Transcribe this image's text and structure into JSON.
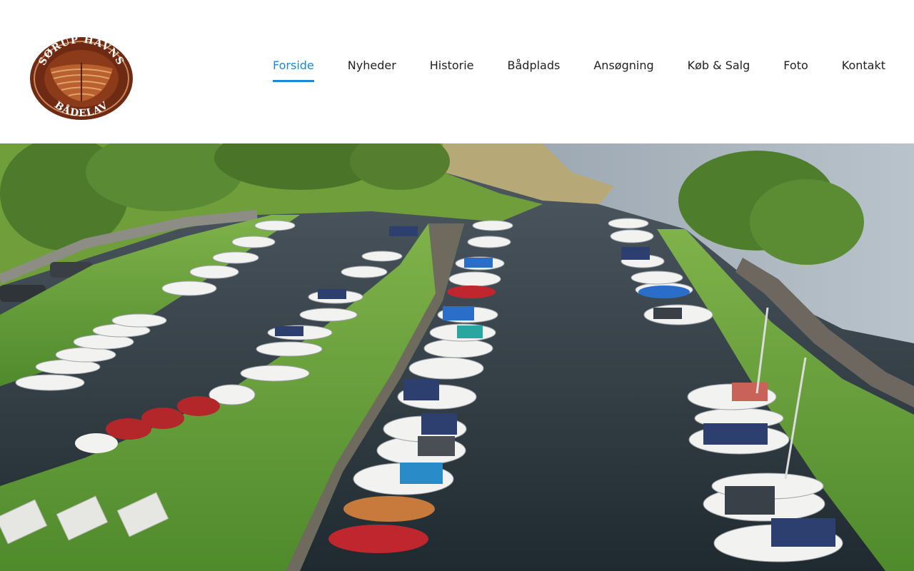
{
  "site": {
    "logo": {
      "icon": "boat-hull-emblem",
      "alt": "Sørup Havns Bådelav",
      "text_top": "SØRUP HAVNS",
      "text_bottom": "BÅDELAV",
      "colors": {
        "outer": "#6e2a12",
        "ring": "#a0522d",
        "wood": "#b8612f",
        "text": "#ffffff"
      }
    }
  },
  "nav": {
    "active_color": "#1e88d6",
    "items": [
      {
        "label": "Forside",
        "active": true
      },
      {
        "label": "Nyheder"
      },
      {
        "label": "Historie"
      },
      {
        "label": "Bådplads"
      },
      {
        "label": "Ansøgning"
      },
      {
        "label": "Køb & Salg"
      },
      {
        "label": "Foto"
      },
      {
        "label": "Kontakt"
      }
    ]
  },
  "hero": {
    "image": "aerial-harbor-photo"
  }
}
